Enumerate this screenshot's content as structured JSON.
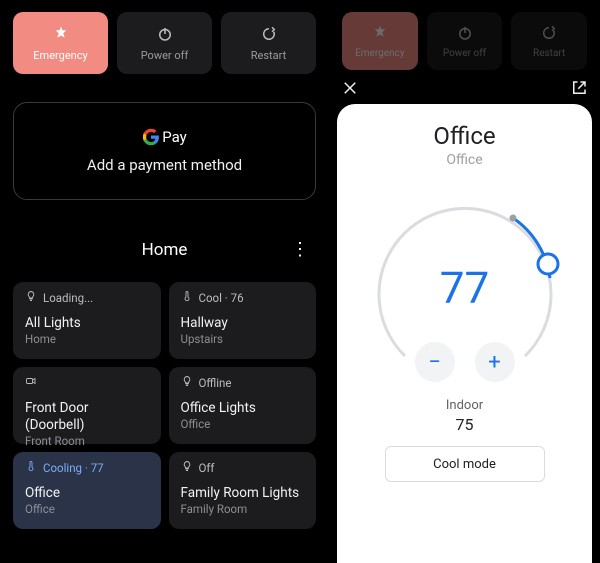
{
  "power": {
    "emergency": "Emergency",
    "poweroff": "Power off",
    "restart": "Restart"
  },
  "pay": {
    "brand_suffix": "Pay",
    "cta": "Add a payment method"
  },
  "home": {
    "title": "Home"
  },
  "tiles": [
    {
      "status": "Loading...",
      "title": "All Lights",
      "sub": "Home",
      "icon": "bulb",
      "accent": false
    },
    {
      "status": "Cool · 76",
      "title": "Hallway",
      "sub": "Upstairs",
      "icon": "thermo",
      "accent": false
    },
    {
      "status": "",
      "title": "Front Door (Doorbell)",
      "sub": "Front Room",
      "icon": "camera",
      "accent": false
    },
    {
      "status": "Offline",
      "title": "Office Lights",
      "sub": "Office",
      "icon": "bulb",
      "accent": false
    },
    {
      "status": "Cooling · 77",
      "title": "Office",
      "sub": "Office",
      "icon": "thermo",
      "accent": true
    },
    {
      "status": "Off",
      "title": "Family Room Lights",
      "sub": "Family Room",
      "icon": "bulb",
      "accent": false
    }
  ],
  "thermo": {
    "title": "Office",
    "sub": "Office",
    "setpoint": "77",
    "indoor_label": "Indoor",
    "indoor_value": "75",
    "mode": "Cool mode"
  }
}
